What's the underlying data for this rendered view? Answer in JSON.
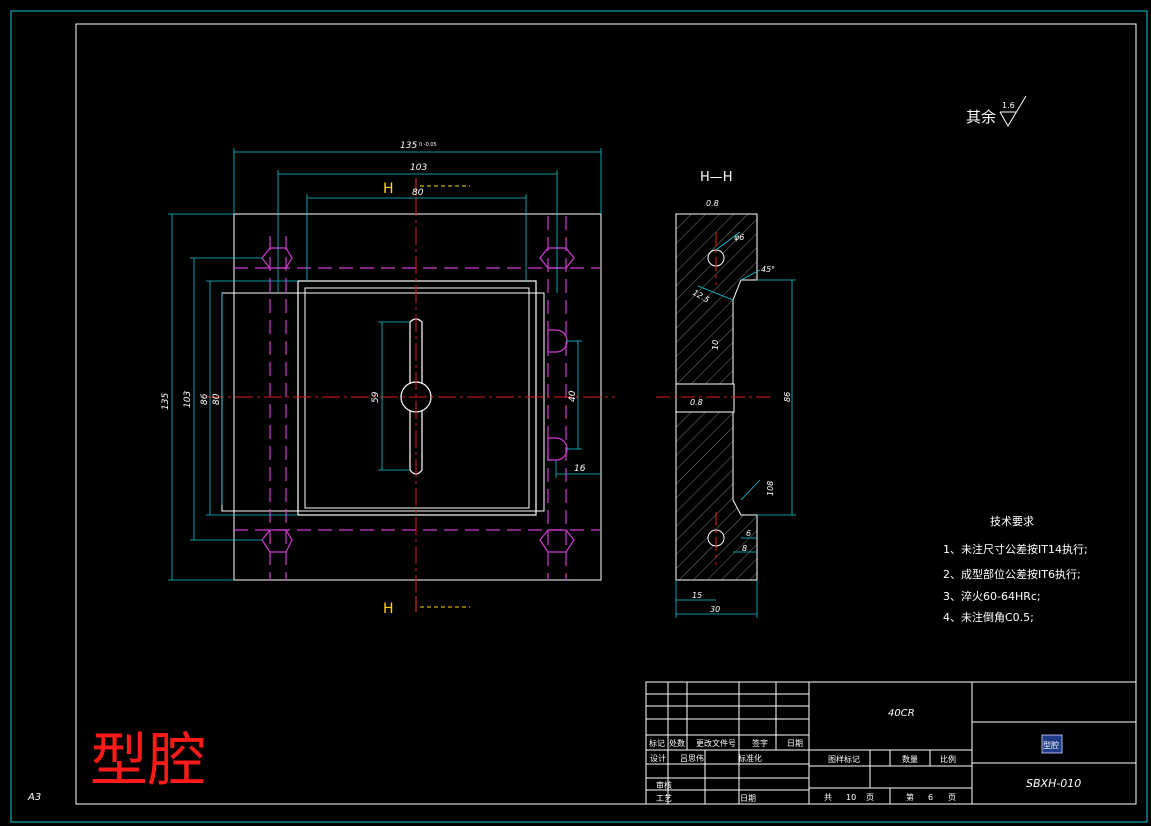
{
  "drawing": {
    "sheet_size": "A3",
    "big_title": "型腔",
    "section_label_top": "H",
    "section_label_bottom": "H",
    "section_view_title": "H—H",
    "roughness_note": "其余",
    "roughness_value": "1.6",
    "tech_requirements": {
      "title": "技术要求",
      "items": [
        "1、未注尺寸公差按IT14执行;",
        "2、成型部位公差按IT6执行;",
        "3、淬火60-64HRc;",
        "4、未注倒角C0.5;"
      ]
    },
    "front_dims": {
      "overall_width": "135",
      "overall_width_tol": "0 -0.05",
      "width_103": "103",
      "width_80": "80",
      "overall_height": "135",
      "height_103": "103",
      "height_86": "86",
      "height_80": "80",
      "slot_59": "59",
      "pin_40": "40",
      "pin_16": "16"
    },
    "section_dims": {
      "r_top": "0.8",
      "hole": "φ6",
      "angle": "45°",
      "r125": "12.5",
      "d10": "10",
      "r_mid": "0.8",
      "d86": "86",
      "d108": "108",
      "d6": "6",
      "d8": "8",
      "d15": "15",
      "d30": "30"
    },
    "title_block": {
      "material": "40CR",
      "drawing_no": "SBXH-010",
      "logo_text": "型腔",
      "rev_headers": [
        "标记",
        "处数",
        "更改文件号",
        "签字",
        "日期"
      ],
      "design_label": "设计",
      "designer": "吕思伟",
      "standard_label": "标准化",
      "review_label": "审核",
      "process_label": "工艺",
      "date_label": "日期",
      "stage_label": "图样标记",
      "qty_label": "数量",
      "scale_label": "比例",
      "total_prefix": "共",
      "total_pages": "10",
      "page_suffix": "页",
      "sheet_prefix": "第",
      "sheet_no": "6",
      "sheet_suffix": "页"
    }
  }
}
